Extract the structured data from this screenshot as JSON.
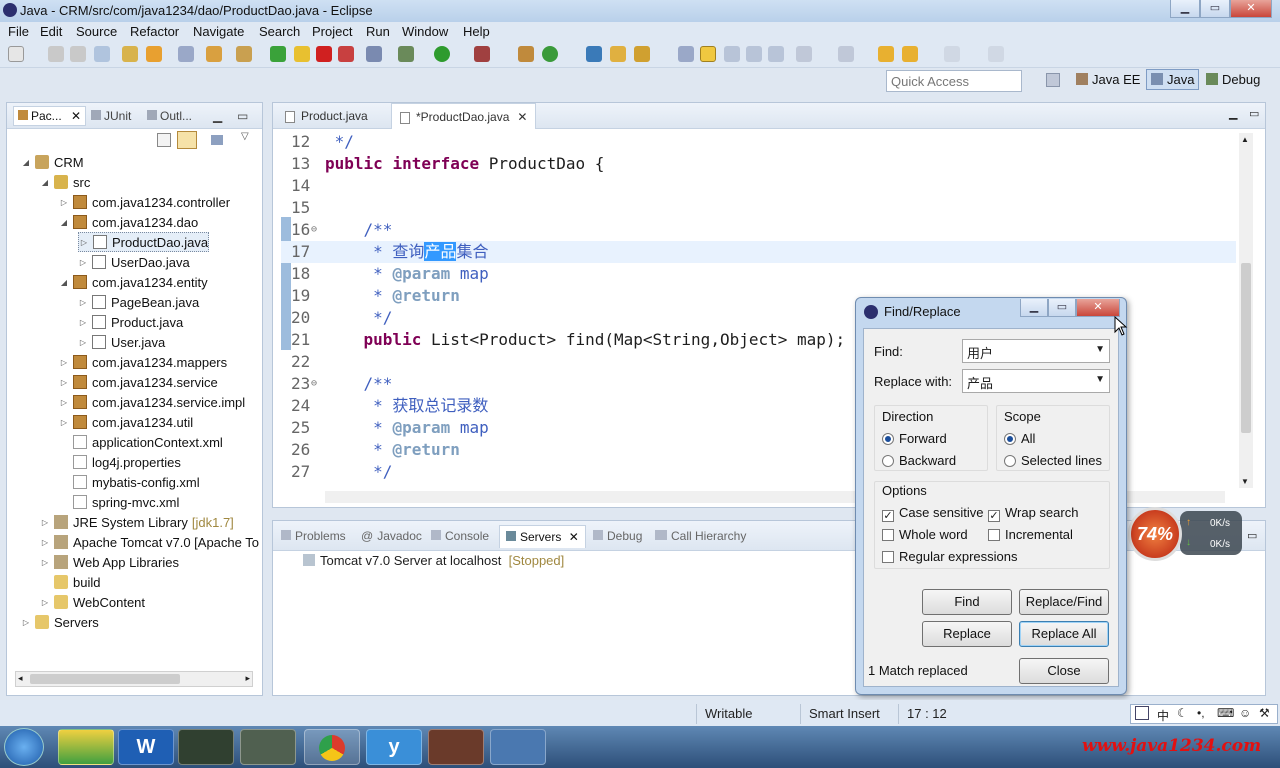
{
  "window": {
    "title": "Java - CRM/src/com/java1234/dao/ProductDao.java - Eclipse"
  },
  "menu": [
    "File",
    "Edit",
    "Source",
    "Refactor",
    "Navigate",
    "Search",
    "Project",
    "Run",
    "Window",
    "Help"
  ],
  "quick_access": {
    "placeholder": "Quick Access"
  },
  "perspectives": [
    "Java EE",
    "Java",
    "Debug"
  ],
  "left_panel": {
    "tabs": [
      "Pac...",
      "JUnit",
      "Outl..."
    ],
    "tree": [
      {
        "label": "CRM",
        "type": "project",
        "expanded": true
      },
      {
        "label": "src",
        "type": "src",
        "expanded": true
      },
      {
        "label": "com.java1234.controller",
        "type": "package"
      },
      {
        "label": "com.java1234.dao",
        "type": "package",
        "expanded": true
      },
      {
        "label": "ProductDao.java",
        "type": "java",
        "selected": true
      },
      {
        "label": "UserDao.java",
        "type": "java"
      },
      {
        "label": "com.java1234.entity",
        "type": "package",
        "expanded": true
      },
      {
        "label": "PageBean.java",
        "type": "java"
      },
      {
        "label": "Product.java",
        "type": "java"
      },
      {
        "label": "User.java",
        "type": "java"
      },
      {
        "label": "com.java1234.mappers",
        "type": "package"
      },
      {
        "label": "com.java1234.service",
        "type": "package"
      },
      {
        "label": "com.java1234.service.impl",
        "type": "package"
      },
      {
        "label": "com.java1234.util",
        "type": "package"
      },
      {
        "label": "applicationContext.xml",
        "type": "xml"
      },
      {
        "label": "log4j.properties",
        "type": "xml"
      },
      {
        "label": "mybatis-config.xml",
        "type": "xml"
      },
      {
        "label": "spring-mvc.xml",
        "type": "xml"
      },
      {
        "label": "JRE System Library",
        "suffix": "[jdk1.7]",
        "type": "lib"
      },
      {
        "label": "Apache Tomcat v7.0 [Apache To",
        "type": "lib"
      },
      {
        "label": "Web App Libraries",
        "type": "lib"
      },
      {
        "label": "build",
        "type": "folder"
      },
      {
        "label": "WebContent",
        "type": "folder"
      },
      {
        "label": "Servers",
        "type": "folder"
      }
    ]
  },
  "editor": {
    "tabs": [
      "Product.java",
      "*ProductDao.java"
    ],
    "lines": [
      {
        "n": "12",
        "text": " */"
      },
      {
        "n": "13",
        "text": "public interface ProductDao {"
      },
      {
        "n": "14",
        "text": ""
      },
      {
        "n": "15",
        "text": ""
      },
      {
        "n": "16",
        "text": "    /**"
      },
      {
        "n": "17",
        "text": "     * 查询产品集合"
      },
      {
        "n": "18",
        "text": "     * @param map"
      },
      {
        "n": "19",
        "text": "     * @return"
      },
      {
        "n": "20",
        "text": "     */"
      },
      {
        "n": "21",
        "text": "    public List<Product> find(Map<String,Object> map);"
      },
      {
        "n": "22",
        "text": ""
      },
      {
        "n": "23",
        "text": "    /**"
      },
      {
        "n": "24",
        "text": "     * 获取总记录数"
      },
      {
        "n": "25",
        "text": "     * @param map"
      },
      {
        "n": "26",
        "text": "     * @return"
      },
      {
        "n": "27",
        "text": "     */"
      }
    ]
  },
  "bottom_panel": {
    "tabs": [
      "Problems",
      "Javadoc",
      "Console",
      "Servers",
      "Debug",
      "Call Hierarchy"
    ],
    "server_name": "Tomcat v7.0 Server at localhost",
    "server_status": "[Stopped]"
  },
  "find_replace": {
    "title": "Find/Replace",
    "find_label": "Find:",
    "find_value": "用户",
    "replace_label": "Replace with:",
    "replace_value": "产品",
    "direction_label": "Direction",
    "direction_forward": "Forward",
    "direction_backward": "Backward",
    "scope_label": "Scope",
    "scope_all": "All",
    "scope_selected": "Selected lines",
    "options_label": "Options",
    "case_sensitive": "Case sensitive",
    "wrap_search": "Wrap search",
    "whole_word": "Whole word",
    "incremental": "Incremental",
    "regex": "Regular expressions",
    "btn_find": "Find",
    "btn_replace_find": "Replace/Find",
    "btn_replace": "Replace",
    "btn_replace_all": "Replace All",
    "btn_close": "Close",
    "status": "1 Match replaced"
  },
  "status_bar": {
    "writable": "Writable",
    "insert_mode": "Smart Insert",
    "position": "17 : 12"
  },
  "widget": {
    "percent": "74%",
    "up": "0K/s",
    "down": "0K/s"
  },
  "taskbar": {
    "watermark": "www.java1234.com",
    "ime": "中"
  }
}
